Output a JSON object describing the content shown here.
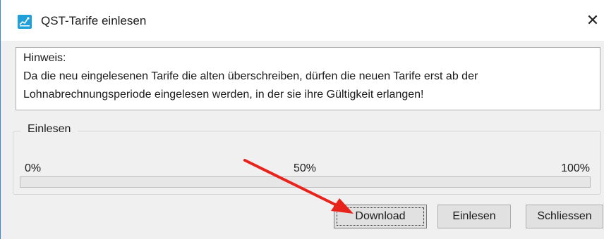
{
  "window": {
    "title": "QST-Tarife einlesen",
    "close_glyph": "✕"
  },
  "hint": {
    "line1": "Hinweis:",
    "line2": "Da die neu eingelesenen Tarife die alten überschreiben, dürfen die neuen Tarife erst ab der",
    "line3": "Lohnabrechnungsperiode eingelesen werden, in der sie ihre Gültigkeit erlangen!"
  },
  "group": {
    "legend": "Einlesen",
    "tick_0": "0%",
    "tick_50": "50%",
    "tick_100": "100%",
    "progress_fraction": 0
  },
  "buttons": {
    "download": "Download",
    "einlesen": "Einlesen",
    "schliessen": "Schliessen"
  },
  "icons": {
    "app": "app-icon",
    "close": "close-icon",
    "annotation": "red-arrow-annotation"
  },
  "colors": {
    "accent": "#1fa0d8",
    "window_border": "#3a86d8",
    "arrow": "#e8231c"
  }
}
